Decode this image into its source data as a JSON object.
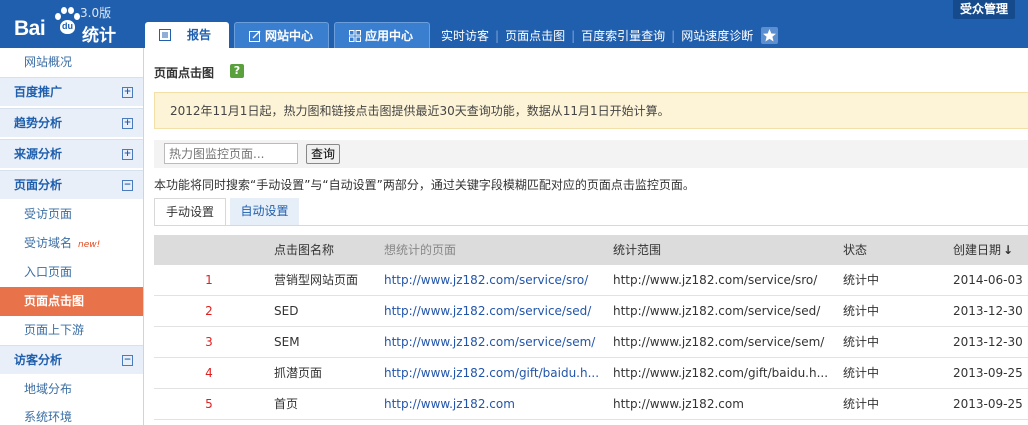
{
  "header": {
    "logo_text": "Bai du",
    "version": "3.0版",
    "product": "统计",
    "user_button": "受众管理",
    "tabs": [
      {
        "label": "报告",
        "active": true
      },
      {
        "label": "网站中心",
        "active": false
      },
      {
        "label": "应用中心",
        "active": false
      }
    ],
    "links": [
      "实时访客",
      "页面点击图",
      "百度索引量查询",
      "网站速度诊断"
    ]
  },
  "sidebar": {
    "items": [
      {
        "label": "网站概况",
        "type": "sub"
      },
      {
        "label": "百度推广",
        "type": "group",
        "toggle": "+"
      },
      {
        "label": "趋势分析",
        "type": "group",
        "toggle": "+"
      },
      {
        "label": "来源分析",
        "type": "group",
        "toggle": "+"
      },
      {
        "label": "页面分析",
        "type": "group",
        "toggle": "−"
      },
      {
        "label": "受访页面",
        "type": "sub"
      },
      {
        "label": "受访域名",
        "type": "sub",
        "badge": "new!"
      },
      {
        "label": "入口页面",
        "type": "sub"
      },
      {
        "label": "页面点击图",
        "type": "active"
      },
      {
        "label": "页面上下游",
        "type": "sub"
      },
      {
        "label": "访客分析",
        "type": "group",
        "toggle": "−"
      },
      {
        "label": "地域分布",
        "type": "sub"
      },
      {
        "label": "系统环境",
        "type": "sub"
      }
    ]
  },
  "main": {
    "title": "页面点击图",
    "help": "?",
    "notice": "2012年11月1日起，热力图和链接点击图提供最近30天查询功能，数据从11月1日开始计算。",
    "search": {
      "placeholder": "热力图监控页面...",
      "button": "查询"
    },
    "description": "本功能将同时搜索“手动设置”与“自动设置”两部分，通过关键字段模糊匹配对应的页面点击监控页面。",
    "subtabs": [
      "手动设置",
      "自动设置"
    ],
    "table": {
      "headers": [
        "点击图名称",
        "想统计的页面",
        "统计范围",
        "状态",
        "创建日期"
      ],
      "rows": [
        {
          "idx": "1",
          "name": "营销型网站页面",
          "page": "http://www.jz182.com/service/sro/",
          "range": "http://www.jz182.com/service/sro/",
          "status": "统计中",
          "date": "2014-06-03"
        },
        {
          "idx": "2",
          "name": "SED",
          "page": "http://www.jz182.com/service/sed/",
          "range": "http://www.jz182.com/service/sed/",
          "status": "统计中",
          "date": "2013-12-30"
        },
        {
          "idx": "3",
          "name": "SEM",
          "page": "http://www.jz182.com/service/sem/",
          "range": "http://www.jz182.com/service/sem/",
          "status": "统计中",
          "date": "2013-12-30"
        },
        {
          "idx": "4",
          "name": "抓潜页面",
          "page": "http://www.jz182.com/gift/baidu.h...",
          "range": "http://www.jz182.com/gift/baidu.h...",
          "status": "统计中",
          "date": "2013-09-25"
        },
        {
          "idx": "5",
          "name": "首页",
          "page": "http://www.jz182.com",
          "range": "http://www.jz182.com",
          "status": "统计中",
          "date": "2013-09-25"
        }
      ]
    }
  }
}
